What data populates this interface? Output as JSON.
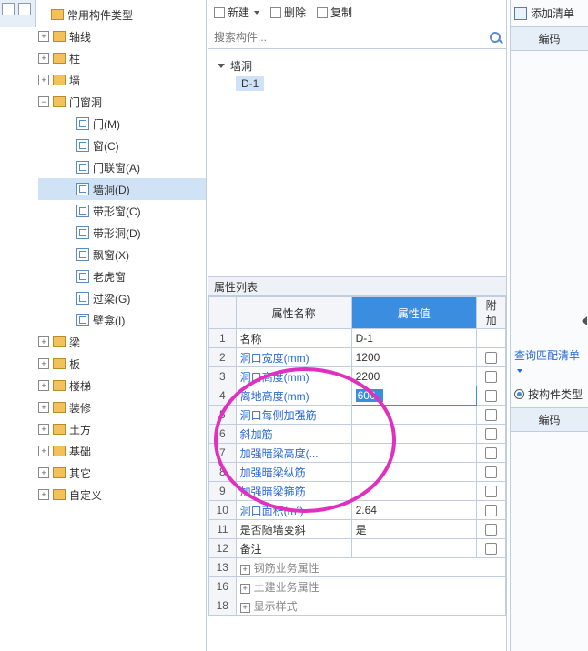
{
  "tree": {
    "n0": "常用构件类型",
    "n1": "轴线",
    "n2": "柱",
    "n3": "墙",
    "n4": "门窗洞",
    "n4_0": "门(M)",
    "n4_1": "窗(C)",
    "n4_2": "门联窗(A)",
    "n4_3": "墙洞(D)",
    "n4_4": "带形窗(C)",
    "n4_5": "带形洞(D)",
    "n4_6": "飘窗(X)",
    "n4_7": "老虎窗",
    "n4_8": "过梁(G)",
    "n4_9": "壁龛(I)",
    "n5": "梁",
    "n6": "板",
    "n7": "楼梯",
    "n8": "装修",
    "n9": "土方",
    "n10": "基础",
    "n11": "其它",
    "n12": "自定义"
  },
  "toolbar": {
    "new": "新建",
    "del": "删除",
    "copy": "复制"
  },
  "search": {
    "placeholder": "搜索构件..."
  },
  "compTree": {
    "root": "墙洞",
    "item": "D-1"
  },
  "propHeader": "属性列表",
  "propCols": {
    "name": "属性名称",
    "value": "属性值",
    "extra": "附加"
  },
  "rows": [
    {
      "n": "1",
      "name": "名称",
      "val": "D-1",
      "chk": false,
      "link": false
    },
    {
      "n": "2",
      "name": "洞口宽度(mm)",
      "val": "1200",
      "chk": true,
      "link": true
    },
    {
      "n": "3",
      "name": "洞口高度(mm)",
      "val": "2200",
      "chk": true,
      "link": true
    },
    {
      "n": "4",
      "name": "离地高度(mm)",
      "val": "600",
      "chk": true,
      "link": true,
      "editing": true
    },
    {
      "n": "5",
      "name": "洞口每侧加强筋",
      "val": "",
      "chk": true,
      "link": true
    },
    {
      "n": "6",
      "name": "斜加筋",
      "val": "",
      "chk": true,
      "link": true
    },
    {
      "n": "7",
      "name": "加强暗梁高度(...",
      "val": "",
      "chk": true,
      "link": true
    },
    {
      "n": "8",
      "name": "加强暗梁纵筋",
      "val": "",
      "chk": true,
      "link": true
    },
    {
      "n": "9",
      "name": "加强暗梁箍筋",
      "val": "",
      "chk": true,
      "link": true
    },
    {
      "n": "10",
      "name": "洞口面积(m²)",
      "val": "2.64",
      "chk": true,
      "link": true
    },
    {
      "n": "11",
      "name": "是否随墙变斜",
      "val": "是",
      "chk": true,
      "link": false
    },
    {
      "n": "12",
      "name": "备注",
      "val": "",
      "chk": true,
      "link": false
    },
    {
      "n": "13",
      "name": "钢筋业务属性",
      "val": "",
      "chk": false,
      "link": false,
      "gray": true,
      "plus": true
    },
    {
      "n": "16",
      "name": "土建业务属性",
      "val": "",
      "chk": false,
      "link": false,
      "gray": true,
      "plus": true
    },
    {
      "n": "18",
      "name": "显示样式",
      "val": "",
      "chk": false,
      "link": false,
      "gray": true,
      "plus": true
    }
  ],
  "right": {
    "addList": "添加清单",
    "code": "编码",
    "matchList": "查询匹配清单",
    "byComp": "按构件类型",
    "code2": "编码"
  }
}
